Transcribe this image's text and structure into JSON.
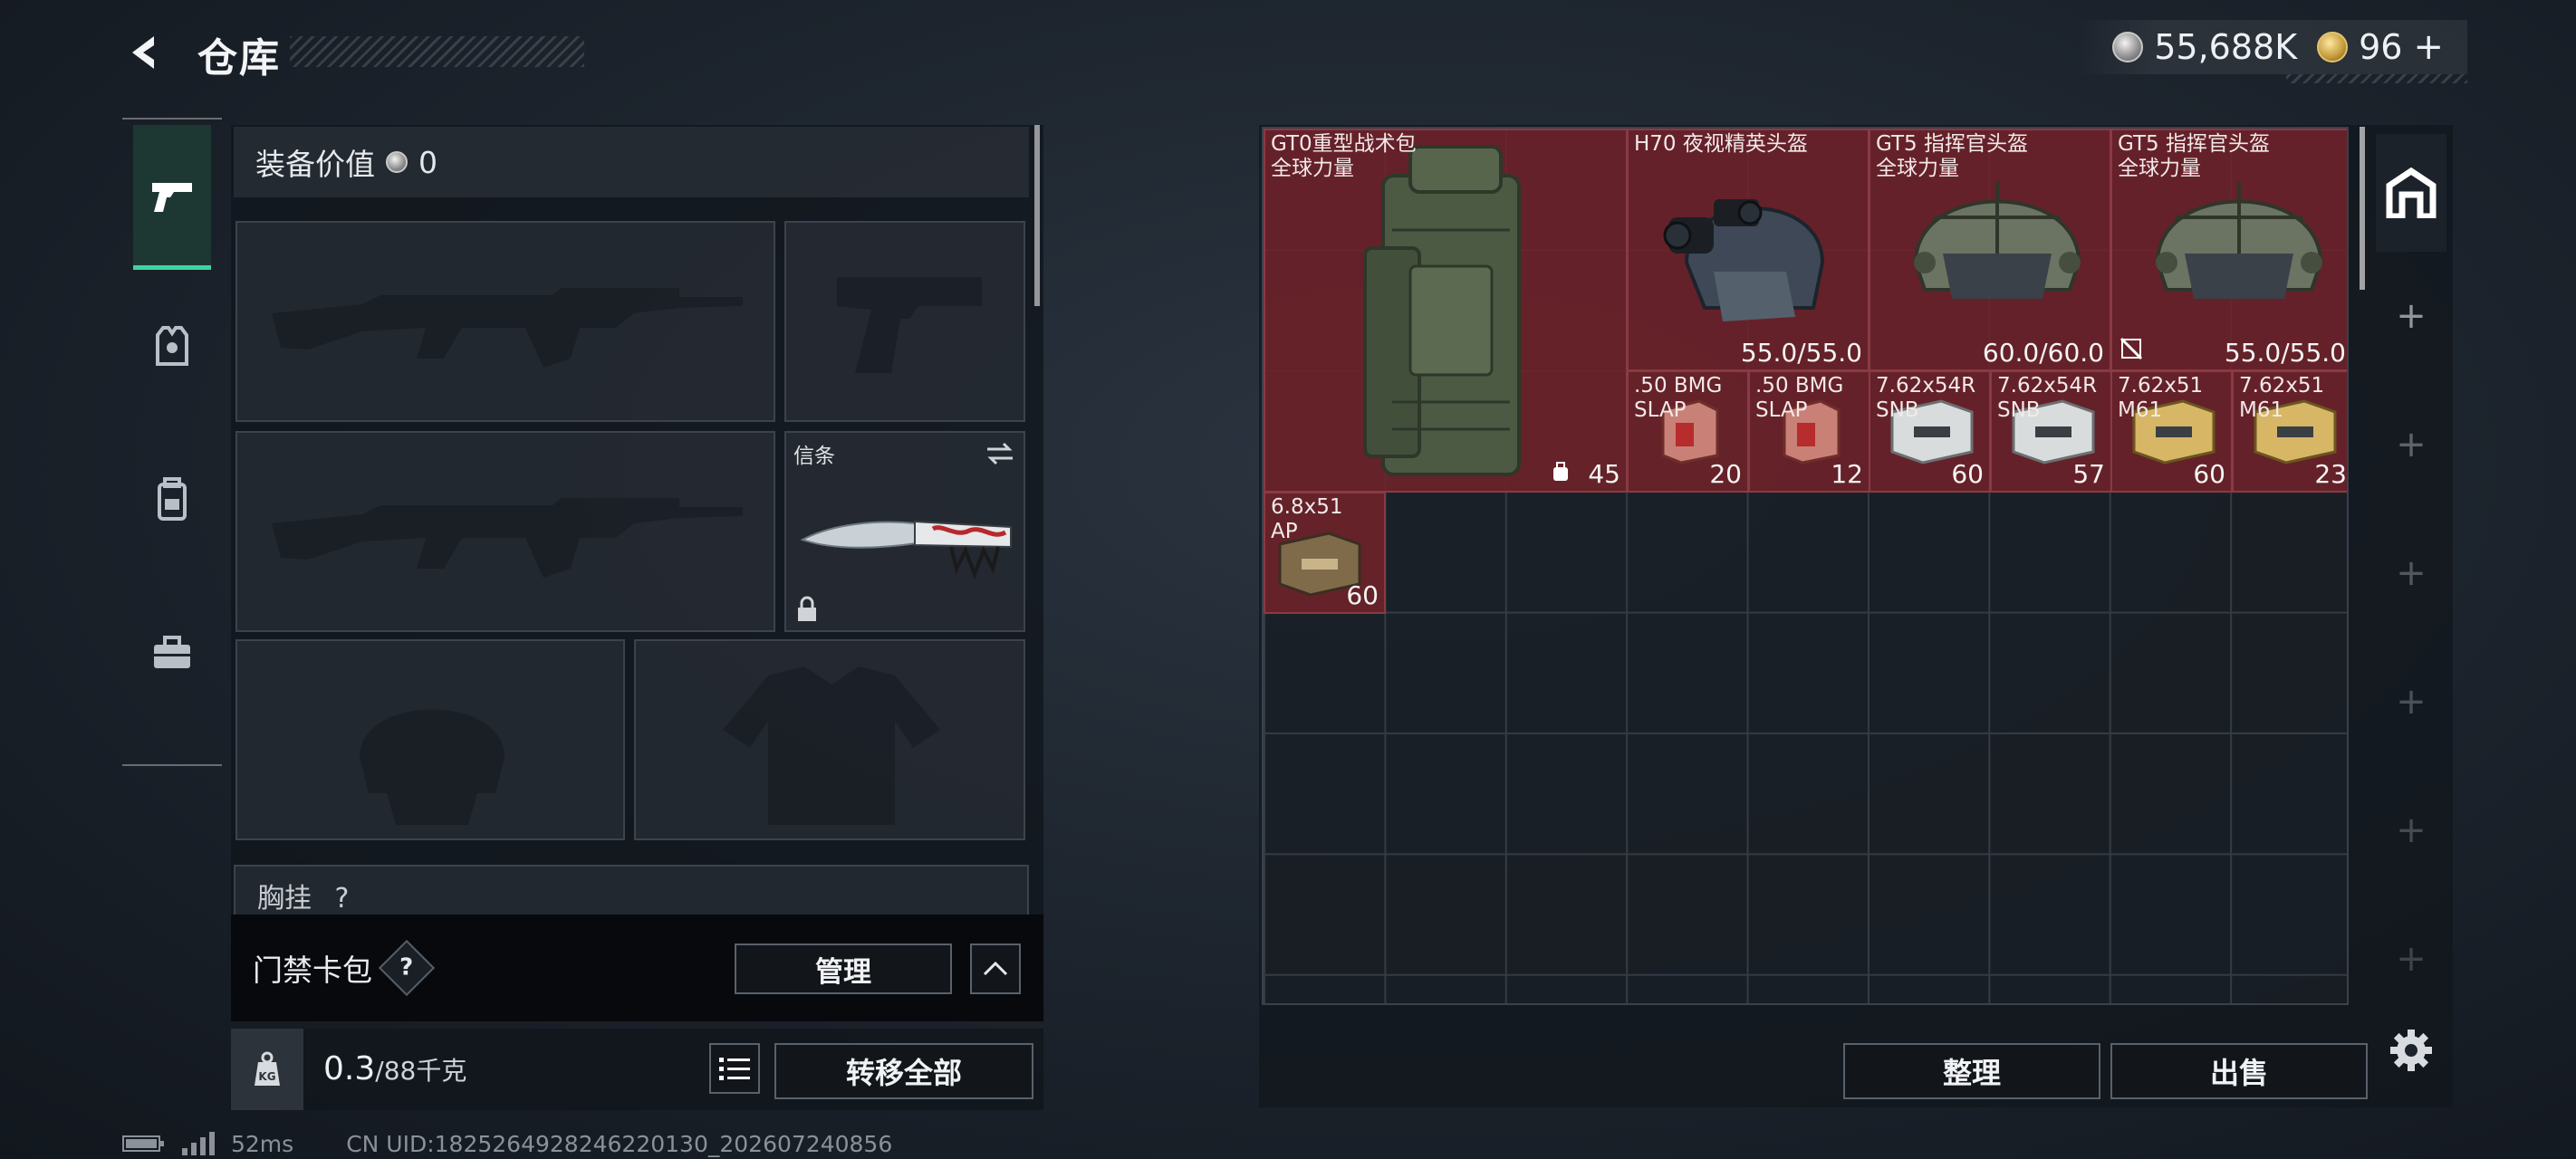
{
  "header": {
    "title": "仓库",
    "currency": [
      {
        "icon": "silver-coin-icon",
        "value": "55,688K"
      },
      {
        "icon": "gold-coin-icon",
        "value": "96"
      }
    ],
    "add_symbol": "+"
  },
  "nav": [
    {
      "icon": "pistol-icon",
      "active": true
    },
    {
      "icon": "armor-vest-icon",
      "active": false
    },
    {
      "icon": "backpack-icon",
      "active": false
    },
    {
      "icon": "toolbox-icon",
      "active": false
    }
  ],
  "equipment": {
    "value_label": "装备价值",
    "value": "0",
    "melee_label": "信条",
    "chest_label": "胸挂",
    "chest_help": "?"
  },
  "card_bar": {
    "label": "门禁卡包",
    "help": "?",
    "manage": "管理"
  },
  "weight": {
    "kg_label": "KG",
    "value": "0.3",
    "unit": "/88千克",
    "transfer_all": "转移全部"
  },
  "status": {
    "ping": "52ms",
    "uid": "CN UID:1825264928246220130_202607240856"
  },
  "stash": {
    "items": [
      {
        "name_line1": "GT0重型战术包",
        "name_line2": "全球力量",
        "value": "45",
        "art": "backpack"
      },
      {
        "name_line1": "H70 夜视精英头盔",
        "name_line2": "",
        "value": "55.0/55.0",
        "art": "helmet-nv"
      },
      {
        "name_line1": "GT5 指挥官头盔",
        "name_line2": "全球力量",
        "value": "60.0/60.0",
        "art": "helmet"
      },
      {
        "name_line1": "GT5 指挥官头盔",
        "name_line2": "全球力量",
        "value": "55.0/55.0",
        "art": "helmet"
      },
      {
        "name_line1": ".50 BMG",
        "name_line2": "SLAP",
        "value": "20",
        "art": "ammo-red"
      },
      {
        "name_line1": ".50 BMG",
        "name_line2": "SLAP",
        "value": "12",
        "art": "ammo-red"
      },
      {
        "name_line1": "7.62x54R",
        "name_line2": "SNB",
        "value": "60",
        "art": "ammo-white"
      },
      {
        "name_line1": "7.62x54R",
        "name_line2": "SNB",
        "value": "57",
        "art": "ammo-white"
      },
      {
        "name_line1": "7.62x51",
        "name_line2": "M61",
        "value": "60",
        "art": "ammo-gold"
      },
      {
        "name_line1": "7.62x51",
        "name_line2": "M61",
        "value": "23",
        "art": "ammo-gold"
      },
      {
        "name_line1": "6.8x51",
        "name_line2": "AP",
        "value": "60",
        "art": "ammo-brown"
      }
    ],
    "sort": "整理",
    "sell": "出售"
  },
  "right_column": {
    "tabs": [
      "storage-icon",
      "add-icon",
      "add-icon",
      "add-icon",
      "add-icon",
      "add-icon",
      "add-icon"
    ]
  },
  "colors": {
    "accent": "#3fd3a3",
    "item_bg": "#70222a",
    "panel_bg": "#11161c"
  }
}
